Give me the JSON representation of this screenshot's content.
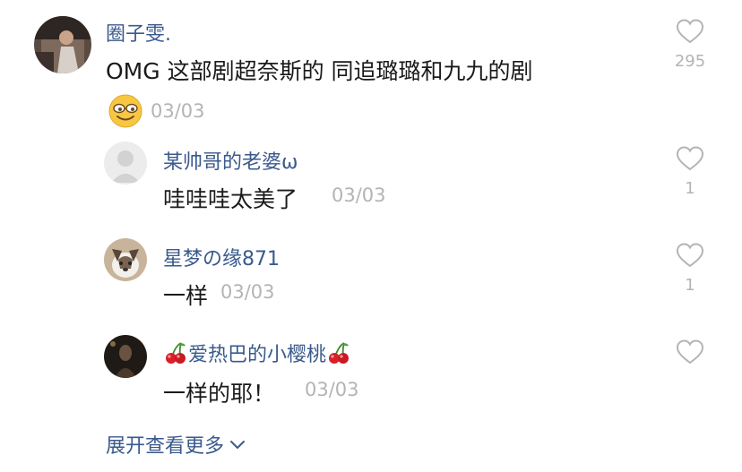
{
  "comment": {
    "username": "圈子雯.",
    "text": "OMG 这部剧超奈斯的 同追璐璐和九九的剧",
    "date": "03/03",
    "likes": "295",
    "emoji": "smiling-sunglasses-emoji"
  },
  "replies": [
    {
      "username": "某帅哥的老婆ω",
      "text": "哇哇哇太美了",
      "date": "03/03",
      "likes": "1",
      "avatar": "default-avatar"
    },
    {
      "username": "星梦の缘871",
      "text": "一样",
      "date": "03/03",
      "likes": "1",
      "avatar": "dog-avatar"
    },
    {
      "username_prefix": "🍒",
      "username": "爱热巴的小樱桃",
      "username_suffix": "🍒",
      "text": "一样的耶！",
      "date": "03/03",
      "likes": "",
      "avatar": "dark-photo-avatar"
    }
  ],
  "more_label": "展开查看更多",
  "colors": {
    "username": "#3a5a8c",
    "date": "#b4b4b4",
    "text": "#1a1a1a"
  }
}
